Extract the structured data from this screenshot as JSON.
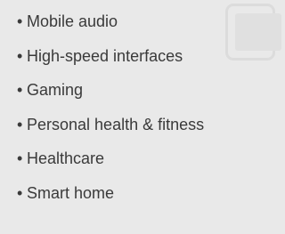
{
  "list": {
    "bullet": "•",
    "items": [
      "Mobile audio",
      "High-speed interfaces",
      "Gaming",
      "Personal health & fitness",
      "Healthcare",
      "Smart home"
    ]
  },
  "background_icon": "device-icon",
  "colors": {
    "background": "#e9e9e9",
    "text": "#3a3a3a",
    "watermark": "#dcdcdc"
  }
}
